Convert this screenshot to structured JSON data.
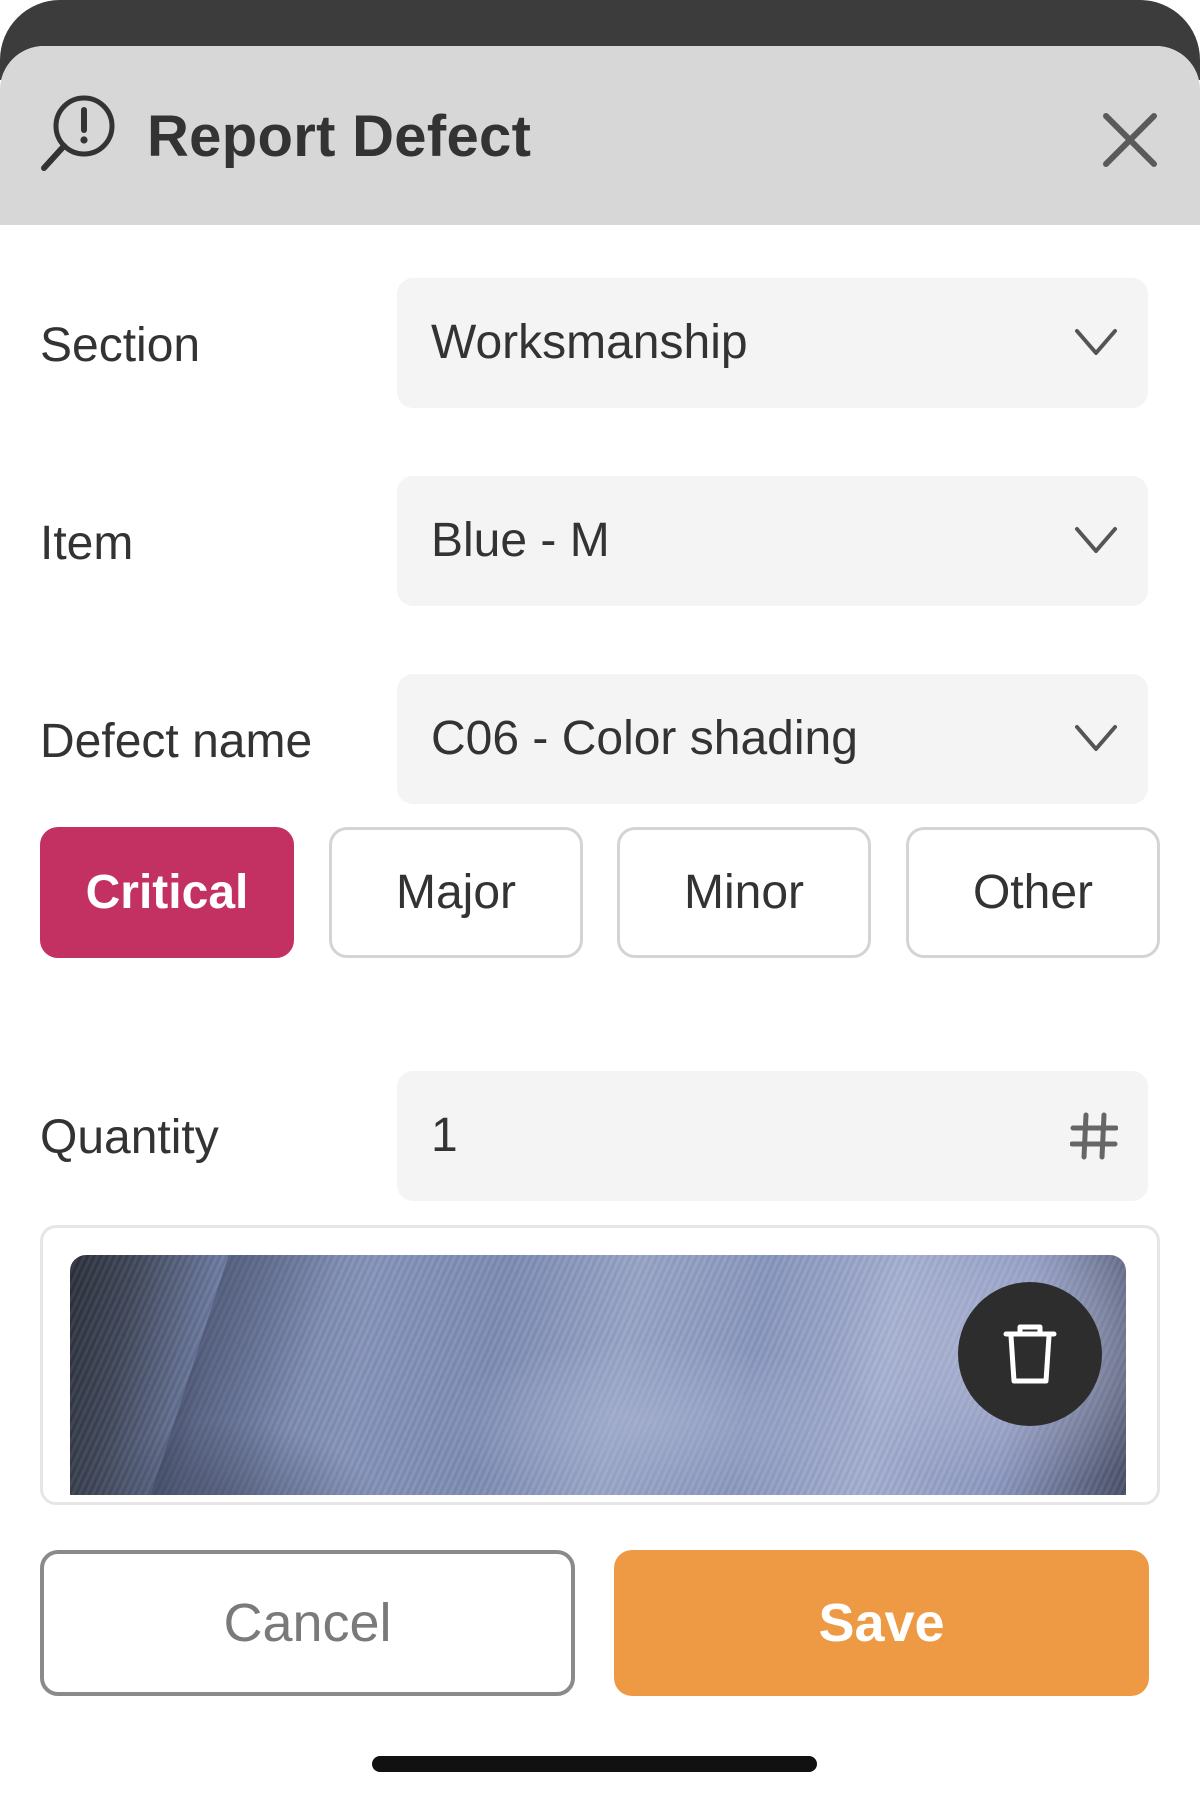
{
  "header": {
    "icon": "report-defect-icon",
    "title": "Report Defect",
    "close_icon": "close-icon"
  },
  "form": {
    "section": {
      "label": "Section",
      "value": "Worksmanship",
      "icon": "chevron-down-icon"
    },
    "item": {
      "label": "Item",
      "value": "Blue - M",
      "icon": "chevron-down-icon"
    },
    "defect_name": {
      "label": "Defect name",
      "value": "C06 - Color shading",
      "icon": "chevron-down-icon"
    },
    "severity": {
      "options": [
        {
          "label": "Critical",
          "selected": true
        },
        {
          "label": "Major",
          "selected": false
        },
        {
          "label": "Minor",
          "selected": false
        },
        {
          "label": "Other",
          "selected": false
        }
      ]
    },
    "quantity": {
      "label": "Quantity",
      "value": "1",
      "icon": "hash-icon"
    }
  },
  "photo": {
    "delete_icon": "trash-icon"
  },
  "actions": {
    "cancel_label": "Cancel",
    "save_label": "Save"
  },
  "colors": {
    "header_bg": "#d7d7d7",
    "critical_accent": "#c23161",
    "save_accent": "#ee9a45",
    "field_bg": "#f4f4f4"
  }
}
